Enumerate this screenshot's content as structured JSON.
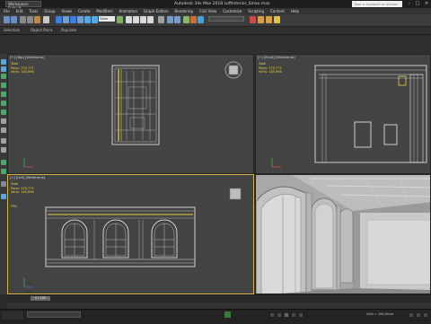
{
  "app": {
    "workspace": "Workspace: Default",
    "title": "Autodesk 3ds Max 2018    LoftInterior_Smax.max",
    "search_placeholder": "Type a keyword or phrase"
  },
  "menu": [
    "File",
    "Edit",
    "Tools",
    "Group",
    "Views",
    "Create",
    "Modifiers",
    "Animation",
    "Graph Editors",
    "Rendering",
    "Civil View",
    "Customize",
    "Scripting",
    "Content",
    "Help"
  ],
  "toolbar": {
    "view_dropdown": "View"
  },
  "ribbon": {
    "tabs": [
      "Selection",
      "Object Paint",
      "Populate"
    ]
  },
  "viewports": {
    "top": {
      "label": "[+] [Top] [Wireframe]"
    },
    "front": {
      "label": "[+] [Front] [Wireframe]"
    },
    "left": {
      "label": "[+] [Left] [Wireframe]",
      "fps": "FPS:"
    },
    "perspective": {
      "label": ""
    },
    "stats": {
      "total": "Total",
      "polys_label": "Polys:",
      "polys": "270,771",
      "verts_label": "Verts:",
      "verts": "185,696"
    }
  },
  "timeline": {
    "frame": "0 / 100"
  },
  "status": {
    "grid": "Grid = 100,0mm"
  },
  "colors": {
    "active_border": "#d4b34a",
    "stats_text": "#e8d34d",
    "viewport_bg": "#434343",
    "wire": "#f2f2f2"
  },
  "icons": [
    "undo-icon",
    "redo-icon",
    "link-icon",
    "unlink-icon",
    "bind-space-warp-icon",
    "select-icon",
    "select-by-name-icon",
    "rect-region-icon",
    "window-crossing-icon",
    "move-icon",
    "rotate-icon",
    "scale-icon",
    "snap-icon",
    "angle-snap-icon",
    "mirror-icon",
    "align-icon",
    "material-editor-icon",
    "render-setup-icon",
    "render-icon",
    "navigation-cube-icon"
  ]
}
